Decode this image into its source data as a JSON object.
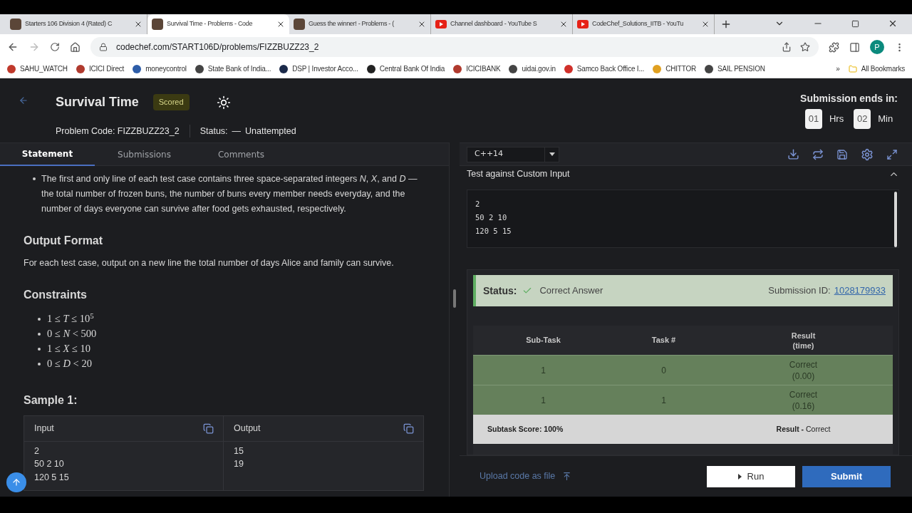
{
  "browser": {
    "tabs": [
      {
        "title": "Starters 106 Division 4 (Rated) C",
        "kind": "codechef",
        "selected": false
      },
      {
        "title": "Survival Time - Problems - Code",
        "kind": "codechef",
        "selected": true
      },
      {
        "title": "Guess the winner! - Problems - (",
        "kind": "codechef",
        "selected": false
      },
      {
        "title": "Channel dashboard - YouTube S",
        "kind": "youtube",
        "selected": false
      },
      {
        "title": "CodeChef_Solutions_IITB - YouTu",
        "kind": "youtube",
        "selected": false
      }
    ],
    "address": "codechef.com/START106D/problems/FIZZBUZZ23_2",
    "profile": "P",
    "bookmarks": [
      {
        "label": "SAHU_WATCH",
        "color": "#c0392b"
      },
      {
        "label": "ICICI Direct",
        "color": "#b03a2e"
      },
      {
        "label": "moneycontrol",
        "color": "#2e5da8"
      },
      {
        "label": "State Bank of India...",
        "color": "#444444"
      },
      {
        "label": "DSP | Investor Acco...",
        "color": "#1b2a4a"
      },
      {
        "label": "Central Bank Of India",
        "color": "#222222"
      },
      {
        "label": "ICICIBANK",
        "color": "#b03a2e"
      },
      {
        "label": "uidai.gov.in",
        "color": "#444444"
      },
      {
        "label": "Samco Back Office I...",
        "color": "#d0302a"
      },
      {
        "label": "CHITTOR",
        "color": "#e0a020"
      },
      {
        "label": "SAIL PENSION",
        "color": "#444444"
      }
    ],
    "more": "»",
    "all_bookmarks": "All Bookmarks"
  },
  "header": {
    "title": "Survival Time",
    "badge": "Scored",
    "problem_code": "Problem Code: FIZZBUZZ23_2",
    "status_label": "Status:",
    "status_dash": "—",
    "status_value": "Unattempted",
    "timer": {
      "label": "Submission ends in:",
      "hours": "01",
      "hours_unit": "Hrs",
      "minutes": "02",
      "minutes_unit": "Min"
    }
  },
  "tabs": [
    {
      "label": "Statement",
      "selected": true
    },
    {
      "label": "Submissions",
      "selected": false
    },
    {
      "label": "Comments",
      "selected": false
    }
  ],
  "statement": {
    "input_bullet": "The first and only line of each test case contains three space-separated integers *N*, *X*, and *D* — the total number of frozen buns, the number of buns every member needs everyday, and the number of days everyone can survive after food gets exhausted, respectively.",
    "output_heading": "Output Format",
    "output_text": "For each test case, output on a new line the total number of days Alice and family can survive.",
    "constraints_heading": "Constraints",
    "constraints": [
      "1 ≤ *T* ≤ 10$^{5}$",
      "0 ≤ *N* < 500",
      "1 ≤ *X* ≤ 10",
      "0 ≤ *D* < 20"
    ],
    "sample_heading": "Sample 1:",
    "sample": {
      "input_label": "Input",
      "output_label": "Output",
      "input_lines": [
        "2",
        "50 2 10",
        "120 5 15"
      ],
      "output_lines": [
        "15",
        "19"
      ]
    }
  },
  "editor": {
    "language": "C++14",
    "custom_input": {
      "title": "Test against Custom Input",
      "expanded": true,
      "lines": [
        "2",
        "50 2 10",
        "120 5 15"
      ]
    },
    "result": {
      "status_label": "Status:",
      "status_value": "Correct Answer",
      "submission_label": "Submission ID:",
      "submission_id": "1028179933",
      "columns": [
        "Sub-Task",
        "Task #",
        "Result",
        "(time)"
      ],
      "rows": [
        {
          "subtask": "1",
          "task": "0",
          "result": "Correct",
          "time": "(0.00)"
        },
        {
          "subtask": "1",
          "task": "1",
          "result": "Correct",
          "time": "(0.16)"
        }
      ],
      "subtask_score": "Subtask Score: 100%",
      "result_label": "Result -",
      "result_value": "Correct"
    },
    "upload": "Upload code as file",
    "run": "Run",
    "submit": "Submit"
  }
}
